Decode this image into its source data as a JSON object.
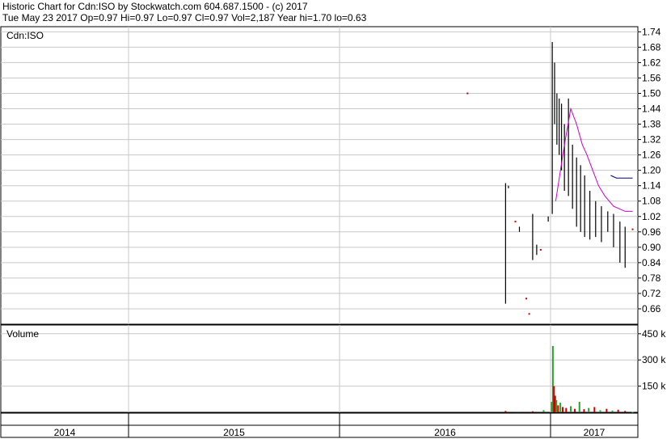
{
  "header": {
    "line1": "Historic Chart for Cdn:ISO by Stockwatch.com 604.687.1500 - (c) 2017",
    "line2": "Tue May 23 2017  Op=0.97  Hi=0.97  Lo=0.97  Cl=0.97  Vol=2,187  Year hi=1.70  lo=0.63"
  },
  "chart_data": {
    "type": "candlestick-ohlc",
    "title": "Cdn:ISO",
    "price_axis": {
      "ticks": [
        "1.74",
        "1.68",
        "1.62",
        "1.56",
        "1.50",
        "1.44",
        "1.38",
        "1.32",
        "1.26",
        "1.20",
        "1.14",
        "1.08",
        "1.02",
        "0.96",
        "0.90",
        "0.84",
        "0.78",
        "0.72",
        "0.66"
      ],
      "range": [
        0.6,
        1.76
      ]
    },
    "volume_panel": {
      "label": "Volume",
      "ticks": [
        "450 k",
        "300 k",
        "150 k"
      ],
      "range": [
        0,
        500000
      ]
    },
    "x_axis": {
      "years": [
        "2014",
        "2015",
        "2016",
        "2017"
      ]
    },
    "colors": {
      "grid": "#c8c8c8",
      "bar": "#000000",
      "up_volume": "#2ca02c",
      "down_volume": "#cc0000",
      "ma_short": "#cc00cc",
      "ma_long": "#000080",
      "dot": "#cc0000"
    },
    "price_series": [
      {
        "date": "2016-10-15",
        "h": 1.15,
        "l": 0.68
      },
      {
        "date": "2016-10-20",
        "h": 1.14,
        "l": 1.13
      },
      {
        "date": "2016-11-01",
        "h": 1.0,
        "l": 1.0
      },
      {
        "date": "2016-11-08",
        "h": 0.98,
        "l": 0.96
      },
      {
        "date": "2016-11-20",
        "h": 0.7,
        "l": 0.7
      },
      {
        "date": "2016-11-25",
        "h": 0.64,
        "l": 0.64
      },
      {
        "date": "2016-12-01",
        "h": 1.03,
        "l": 0.85
      },
      {
        "date": "2016-12-08",
        "h": 0.91,
        "l": 0.87
      },
      {
        "date": "2016-12-15",
        "h": 0.89,
        "l": 0.89
      },
      {
        "date": "2016-12-28",
        "h": 1.02,
        "l": 1.0
      },
      {
        "date": "2017-01-04",
        "h": 1.7,
        "l": 1.03
      },
      {
        "date": "2017-01-08",
        "h": 1.62,
        "l": 1.38
      },
      {
        "date": "2017-01-12",
        "h": 1.5,
        "l": 1.3
      },
      {
        "date": "2017-01-16",
        "h": 1.48,
        "l": 1.26
      },
      {
        "date": "2017-01-20",
        "h": 1.46,
        "l": 1.2
      },
      {
        "date": "2017-01-25",
        "h": 1.38,
        "l": 1.12
      },
      {
        "date": "2017-02-01",
        "h": 1.48,
        "l": 1.1
      },
      {
        "date": "2017-02-08",
        "h": 1.3,
        "l": 1.05
      },
      {
        "date": "2017-02-15",
        "h": 1.25,
        "l": 0.98
      },
      {
        "date": "2017-02-22",
        "h": 1.22,
        "l": 0.96
      },
      {
        "date": "2017-03-01",
        "h": 1.18,
        "l": 0.94
      },
      {
        "date": "2017-03-10",
        "h": 1.12,
        "l": 0.93
      },
      {
        "date": "2017-03-20",
        "h": 1.08,
        "l": 0.94
      },
      {
        "date": "2017-03-30",
        "h": 1.06,
        "l": 0.92
      },
      {
        "date": "2017-04-10",
        "h": 1.04,
        "l": 0.96
      },
      {
        "date": "2017-04-20",
        "h": 1.03,
        "l": 0.9
      },
      {
        "date": "2017-05-01",
        "h": 1.0,
        "l": 0.84
      },
      {
        "date": "2017-05-10",
        "h": 0.98,
        "l": 0.82
      },
      {
        "date": "2017-05-23",
        "h": 0.97,
        "l": 0.97
      }
    ],
    "ma_short": [
      {
        "date": "2017-01-10",
        "v": 1.08
      },
      {
        "date": "2017-01-25",
        "v": 1.3
      },
      {
        "date": "2017-02-05",
        "v": 1.44
      },
      {
        "date": "2017-02-15",
        "v": 1.38
      },
      {
        "date": "2017-02-25",
        "v": 1.3
      },
      {
        "date": "2017-03-05",
        "v": 1.26
      },
      {
        "date": "2017-03-15",
        "v": 1.2
      },
      {
        "date": "2017-03-25",
        "v": 1.14
      },
      {
        "date": "2017-04-05",
        "v": 1.1
      },
      {
        "date": "2017-04-20",
        "v": 1.06
      },
      {
        "date": "2017-05-10",
        "v": 1.04
      },
      {
        "date": "2017-05-23",
        "v": 1.04
      }
    ],
    "ma_long": [
      {
        "date": "2017-04-15",
        "v": 1.18
      },
      {
        "date": "2017-04-25",
        "v": 1.17
      },
      {
        "date": "2017-05-23",
        "v": 1.17
      }
    ],
    "volume_series": [
      {
        "date": "2016-10-15",
        "v": 8000,
        "up": false
      },
      {
        "date": "2016-11-05",
        "v": 4000,
        "up": true
      },
      {
        "date": "2016-12-01",
        "v": 6000,
        "up": false
      },
      {
        "date": "2016-12-20",
        "v": 12000,
        "up": true
      },
      {
        "date": "2017-01-03",
        "v": 60000,
        "up": true
      },
      {
        "date": "2017-01-05",
        "v": 380000,
        "up": true
      },
      {
        "date": "2017-01-07",
        "v": 150000,
        "up": false
      },
      {
        "date": "2017-01-09",
        "v": 95000,
        "up": false
      },
      {
        "date": "2017-01-11",
        "v": 70000,
        "up": true
      },
      {
        "date": "2017-01-14",
        "v": 40000,
        "up": false
      },
      {
        "date": "2017-01-18",
        "v": 55000,
        "up": true
      },
      {
        "date": "2017-01-22",
        "v": 30000,
        "up": false
      },
      {
        "date": "2017-01-28",
        "v": 25000,
        "up": false
      },
      {
        "date": "2017-02-05",
        "v": 35000,
        "up": true
      },
      {
        "date": "2017-02-12",
        "v": 20000,
        "up": false
      },
      {
        "date": "2017-02-20",
        "v": 60000,
        "up": true
      },
      {
        "date": "2017-02-28",
        "v": 18000,
        "up": false
      },
      {
        "date": "2017-03-08",
        "v": 25000,
        "up": true
      },
      {
        "date": "2017-03-18",
        "v": 30000,
        "up": false
      },
      {
        "date": "2017-03-28",
        "v": 12000,
        "up": true
      },
      {
        "date": "2017-04-08",
        "v": 20000,
        "up": false
      },
      {
        "date": "2017-04-18",
        "v": 10000,
        "up": true
      },
      {
        "date": "2017-04-28",
        "v": 15000,
        "up": false
      },
      {
        "date": "2017-05-10",
        "v": 8000,
        "up": false
      },
      {
        "date": "2017-05-23",
        "v": 2187,
        "up": true
      }
    ],
    "dots": [
      {
        "date": "2016-08-10",
        "v": 1.5
      }
    ]
  }
}
